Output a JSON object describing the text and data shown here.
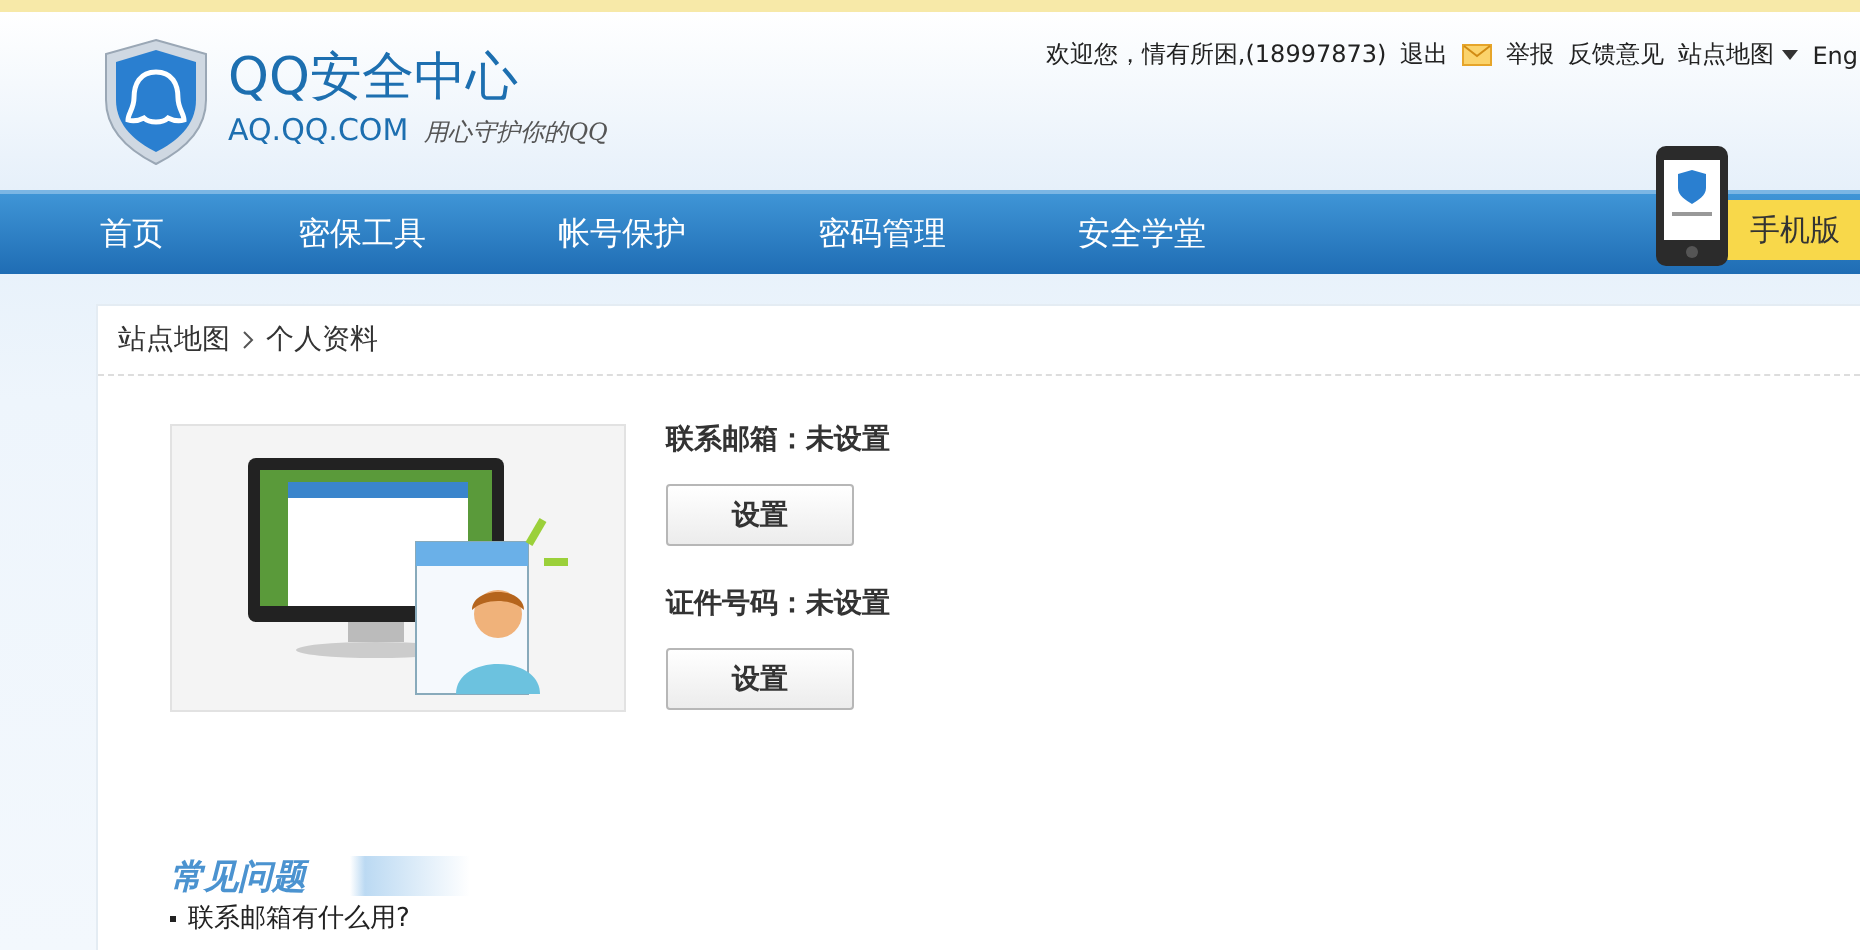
{
  "header": {
    "logo_title": "QQ安全中心",
    "logo_domain": "AQ.QQ.COM",
    "logo_slogan": "用心守护你的QQ",
    "user_links": [
      {
        "kind": "text",
        "label": "欢迎您，情有所困,(18997873)"
      },
      {
        "kind": "link",
        "label": "退出"
      },
      {
        "kind": "mail"
      },
      {
        "kind": "link",
        "label": "举报"
      },
      {
        "kind": "link",
        "label": "反馈意见"
      },
      {
        "kind": "dropdown",
        "label": "站点地图"
      },
      {
        "kind": "link",
        "label": "Eng"
      }
    ]
  },
  "nav": {
    "items": [
      {
        "label": "首页",
        "selected": false
      },
      {
        "label": "密保工具",
        "selected": false
      },
      {
        "label": "帐号保护",
        "selected": false
      },
      {
        "label": "密码管理",
        "selected": false
      },
      {
        "label": "安全学堂",
        "selected": false
      }
    ],
    "mobile_badge": "手机版"
  },
  "breadcrumb": [
    "站点地图",
    "个人资料"
  ],
  "profile": [
    {
      "label": "联系邮箱：",
      "value": "未设置",
      "button": "设置"
    },
    {
      "label": "证件号码：",
      "value": "未设置",
      "button": "设置"
    }
  ],
  "faq": {
    "title": "常见问题",
    "items": [
      "联系邮箱有什么用?"
    ]
  }
}
